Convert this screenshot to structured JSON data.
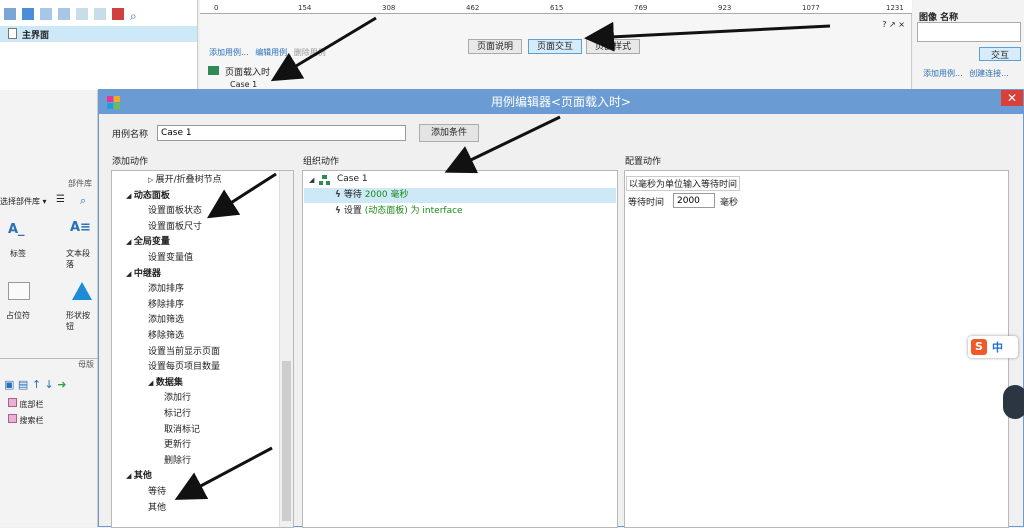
{
  "background": {
    "sitemap": {
      "home_page": "主界面"
    },
    "ruler_ticks": [
      "0",
      "154",
      "308",
      "462",
      "615",
      "769",
      "923",
      "1077",
      "1231"
    ],
    "page_tabs": [
      "页面说明",
      "页面交互",
      "页面样式"
    ],
    "usecase_links": {
      "add": "添加用例...",
      "edit": "编辑用例",
      "delete": "删除用例"
    },
    "event_label": "页面载入时",
    "case_label": "Case 1",
    "window_controls": "? ↗ ×",
    "right_panel": {
      "title": "图像 名称",
      "tab": "交互",
      "add_link": "添加用例...",
      "create_link": "创建连接..."
    },
    "library": {
      "title": "部件库",
      "select_label": "选择部件库 ▾",
      "items": [
        "标签",
        "文本段落",
        "占位符",
        "形状按钮"
      ]
    },
    "masters": {
      "title": "母版",
      "items": [
        "底部栏",
        "搜索栏"
      ]
    },
    "ime": {
      "label": "中"
    }
  },
  "dialog": {
    "title": "用例编辑器<页面载入时>",
    "case_name_label": "用例名称",
    "case_name_value": "Case 1",
    "add_condition": "添加条件",
    "add_actions_header": "添加动作",
    "organize_header": "组织动作",
    "configure_header": "配置动作",
    "action_tree": [
      {
        "label": "展开/折叠树节点",
        "level": 1,
        "bold": false
      },
      {
        "label": "动态面板",
        "level": 0,
        "bold": true
      },
      {
        "label": "设置面板状态",
        "level": 1,
        "bold": false
      },
      {
        "label": "设置面板尺寸",
        "level": 1,
        "bold": false
      },
      {
        "label": "全局变量",
        "level": 0,
        "bold": true
      },
      {
        "label": "设置变量值",
        "level": 1,
        "bold": false
      },
      {
        "label": "中继器",
        "level": 0,
        "bold": true
      },
      {
        "label": "添加排序",
        "level": 1,
        "bold": false
      },
      {
        "label": "移除排序",
        "level": 1,
        "bold": false
      },
      {
        "label": "添加筛选",
        "level": 1,
        "bold": false
      },
      {
        "label": "移除筛选",
        "level": 1,
        "bold": false
      },
      {
        "label": "设置当前显示页面",
        "level": 1,
        "bold": false
      },
      {
        "label": "设置每页项目数量",
        "level": 1,
        "bold": false
      },
      {
        "label": "数据集",
        "level": 1,
        "bold": true
      },
      {
        "label": "添加行",
        "level": 2,
        "bold": false
      },
      {
        "label": "标记行",
        "level": 2,
        "bold": false
      },
      {
        "label": "取消标记",
        "level": 2,
        "bold": false
      },
      {
        "label": "更新行",
        "level": 2,
        "bold": false
      },
      {
        "label": "删除行",
        "level": 2,
        "bold": false
      },
      {
        "label": "其他",
        "level": 0,
        "bold": true
      },
      {
        "label": "等待",
        "level": 1,
        "bold": false
      },
      {
        "label": "其他",
        "level": 1,
        "bold": false
      }
    ],
    "organize": {
      "case": "Case 1",
      "actions": [
        {
          "prefix": "等待 ",
          "highlight": "2000 毫秒",
          "suffix": ""
        },
        {
          "prefix": "设置 ",
          "highlight": "(动态面板) 为 interface",
          "suffix": ""
        }
      ]
    },
    "configure": {
      "hint": "以毫秒为单位输入等待时间",
      "wait_label": "等待时间",
      "wait_value": "2000",
      "unit": "毫秒"
    }
  }
}
